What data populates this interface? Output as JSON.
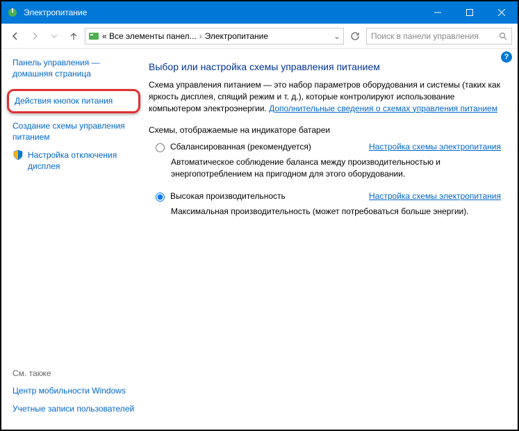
{
  "titlebar": {
    "title": "Электропитание"
  },
  "nav": {
    "crumb1": "« Все элементы панел...",
    "crumb2": "Электропитание"
  },
  "search": {
    "placeholder": "Поиск в панели управления"
  },
  "sidebar": {
    "home": "Панель управления — домашняя страница",
    "buttons_action": "Действия кнопок питания",
    "create_plan": "Создание схемы управления питанием",
    "display_off": "Настройка отключения дисплея",
    "see_also": "См. также",
    "mobility": "Центр мобильности Windows",
    "accounts": "Учетные записи пользователей"
  },
  "main": {
    "heading": "Выбор или настройка схемы управления питанием",
    "desc_pre": "Схема управления питанием — это набор параметров оборудования и системы (таких как яркость дисплея, спящий режим и т. д.), которые контролируют использование компьютером электроэнергии. ",
    "desc_link": "Дополнительные сведения о схемах управления питанием",
    "plans_label": "Схемы, отображаемые на индикаторе батареи",
    "plan1": {
      "name": "Сбалансированная (рекомендуется)",
      "link": "Настройка схемы электропитания",
      "desc": "Автоматическое соблюдение баланса между производительностью и энергопотреблением на пригодном для этого оборудовании."
    },
    "plan2": {
      "name": "Высокая производительность",
      "link": "Настройка схемы электропитания",
      "desc": "Максимальная производительность (может потребоваться больше энергии)."
    }
  }
}
